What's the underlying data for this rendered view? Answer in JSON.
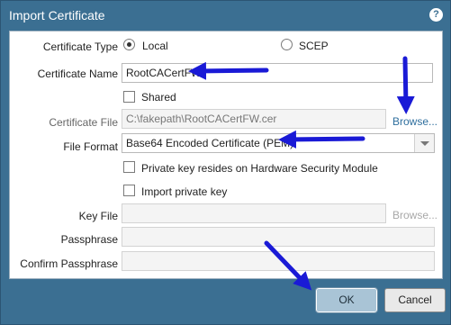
{
  "dialog": {
    "title": "Import Certificate",
    "help_icon": "help-icon"
  },
  "form": {
    "certificate_type": {
      "label": "Certificate Type",
      "options": [
        "Local",
        "SCEP"
      ],
      "selected": "Local"
    },
    "certificate_name": {
      "label": "Certificate Name",
      "value": "RootCACertFW"
    },
    "shared": {
      "label": "Shared",
      "checked": false
    },
    "certificate_file": {
      "label": "Certificate File",
      "value": "C:\\fakepath\\RootCACertFW.cer",
      "browse_label": "Browse..."
    },
    "file_format": {
      "label": "File Format",
      "selected": "Base64 Encoded Certificate (PEM)"
    },
    "private_key_hsm": {
      "label": "Private key resides on Hardware Security Module",
      "checked": false
    },
    "import_private_key": {
      "label": "Import private key",
      "checked": false
    },
    "key_file": {
      "label": "Key File",
      "value": "",
      "browse_label": "Browse..."
    },
    "passphrase": {
      "label": "Passphrase",
      "value": ""
    },
    "confirm_passphrase": {
      "label": "Confirm Passphrase",
      "value": ""
    }
  },
  "buttons": {
    "ok_label": "OK",
    "cancel_label": "Cancel"
  },
  "colors": {
    "dialog_bg": "#3b6f92",
    "annotation_arrows": "#1a1ad6",
    "browse_link": "#2f6f9e"
  }
}
